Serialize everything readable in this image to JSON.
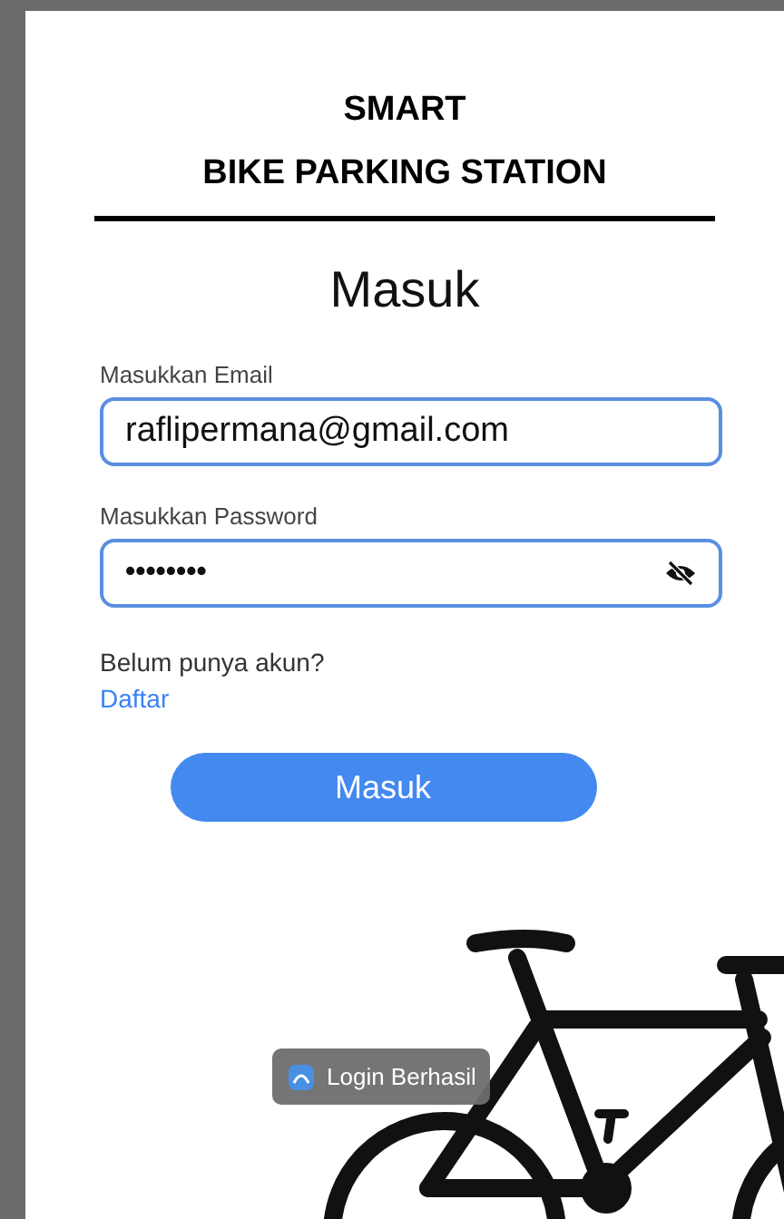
{
  "header": {
    "title_line_1": "SMART",
    "title_line_2": "BIKE PARKING STATION"
  },
  "heading": "Masuk",
  "email": {
    "label": "Masukkan Email",
    "value": "raflipermana@gmail.com"
  },
  "password": {
    "label": "Masukkan Password",
    "value": "••••••••",
    "visible": false
  },
  "signup": {
    "prompt": "Belum punya akun?",
    "link": "Daftar"
  },
  "submit_button": "Masuk",
  "toast": "Login Berhasil"
}
